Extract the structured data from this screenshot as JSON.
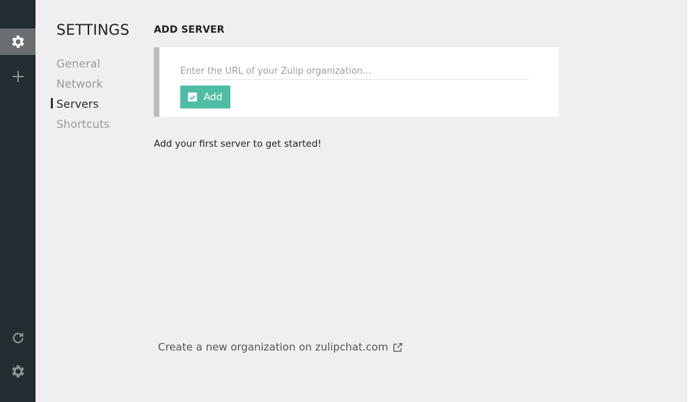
{
  "sidebar": {
    "settings_icon": "gear-icon",
    "add_icon": "plus-icon",
    "reload_icon": "reload-icon",
    "bottom_settings_icon": "gear-icon"
  },
  "settings": {
    "title": "SETTINGS",
    "nav": [
      {
        "label": "General",
        "active": false
      },
      {
        "label": "Network",
        "active": false
      },
      {
        "label": "Servers",
        "active": true
      },
      {
        "label": "Shortcuts",
        "active": false
      }
    ]
  },
  "servers": {
    "section_title": "ADD SERVER",
    "url_input": {
      "value": "",
      "placeholder": "Enter the URL of your Zulip organization..."
    },
    "add_label": "Add",
    "empty_message": "Add your first server to get started!",
    "create_org_link": "Create a new organization on zulipchat.com"
  },
  "colors": {
    "sidebar_bg": "#222c31",
    "accent": "#4fbda5",
    "page_bg": "#efefef"
  }
}
